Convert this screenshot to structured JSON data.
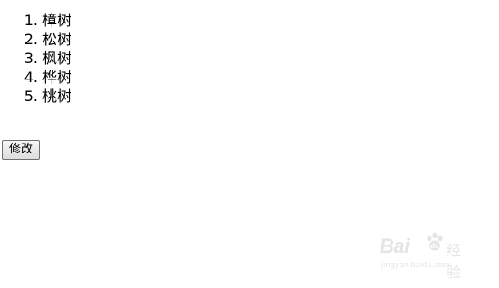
{
  "tree_list": {
    "items": [
      {
        "number": "1.",
        "label": "樟树"
      },
      {
        "number": "2.",
        "label": "松树"
      },
      {
        "number": "3.",
        "label": "枫树"
      },
      {
        "number": "4.",
        "label": "桦树"
      },
      {
        "number": "5.",
        "label": "桃树"
      }
    ]
  },
  "actions": {
    "modify_label": "修改"
  },
  "watermark": {
    "brand": "Bai",
    "suffix": "经验",
    "url": "jingyan.baidu.com"
  }
}
